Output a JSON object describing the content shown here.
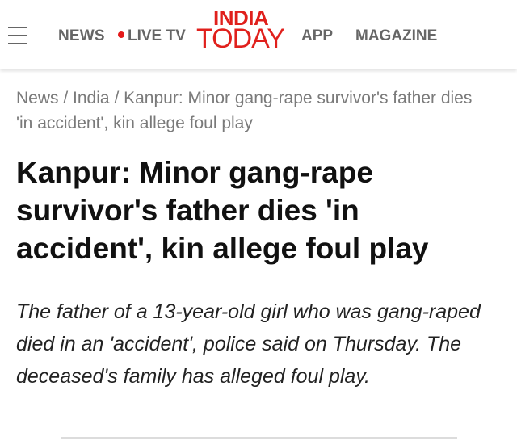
{
  "header": {
    "nav": {
      "news": "NEWS",
      "live_tv": "LIVE TV",
      "app": "APP",
      "magazine": "MAGAZINE"
    },
    "logo": {
      "top": "INDIA",
      "bottom": "TODAY"
    },
    "icons": {
      "menu": "hamburger-menu-icon",
      "live": "live-dot-icon"
    }
  },
  "breadcrumb": {
    "items": [
      "News",
      "India",
      "Kanpur: Minor gang-rape survivor's father dies 'in accident', kin allege foul play"
    ],
    "separator": "/"
  },
  "article": {
    "headline": "Kanpur: Minor gang-rape survivor's father dies 'in accident', kin allege foul play",
    "summary": "The father of a 13-year-old girl who was gang-raped died in an 'accident', police said on Thursday. The deceased's family has alleged foul play."
  },
  "colors": {
    "brand_red": "#e0201c",
    "nav_gray": "#666666",
    "breadcrumb_gray": "#7a7a7a",
    "live_dot": "#e41a1a"
  }
}
